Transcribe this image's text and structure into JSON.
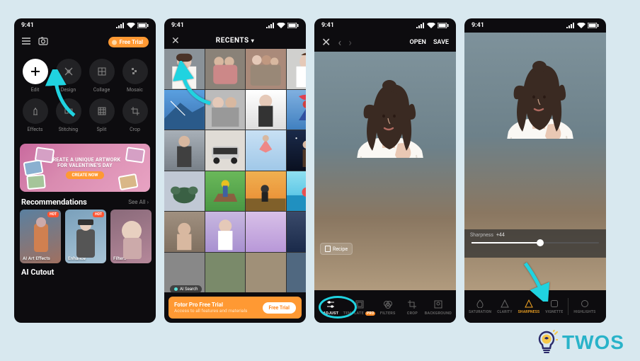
{
  "status": {
    "time": "9:41"
  },
  "phone1": {
    "free_trial": "Free Trial",
    "tools": [
      {
        "id": "edit",
        "label": "Edit"
      },
      {
        "id": "design",
        "label": "Design"
      },
      {
        "id": "collage",
        "label": "Collage"
      },
      {
        "id": "mosaic",
        "label": "Mosaic"
      },
      {
        "id": "effects",
        "label": "Effects"
      },
      {
        "id": "stitching",
        "label": "Stitching"
      },
      {
        "id": "split",
        "label": "Split"
      },
      {
        "id": "crop",
        "label": "Crop"
      }
    ],
    "banner": {
      "line1": "CREATE A UNIQUE ARTWORK",
      "line2": "FOR VALENTINE'S DAY",
      "cta": "CREATE NOW"
    },
    "recommendations": {
      "title": "Recommendations",
      "see_all": "See All ›"
    },
    "rec_items": [
      {
        "label": "AI Art Effects",
        "hot": true
      },
      {
        "label": "Enhance",
        "hot": true
      },
      {
        "label": "Filters",
        "hot": false
      }
    ],
    "ai_cutout": "AI Cutout"
  },
  "phone2": {
    "title": "RECENTS",
    "ai_search": "AI Search",
    "promo": {
      "title": "Fotor Pro Free Trial",
      "sub": "Access to all features and materials",
      "btn": "Free Trial"
    }
  },
  "phone3": {
    "open": "OPEN",
    "save": "SAVE",
    "recipe": "Recipe",
    "tabs": [
      {
        "id": "adjust",
        "label": "ADJUST",
        "active": true
      },
      {
        "id": "template",
        "label": "TEMPLATE",
        "pro": "PRO"
      },
      {
        "id": "filters",
        "label": "FILTERS"
      },
      {
        "id": "crop",
        "label": "CROP"
      },
      {
        "id": "background",
        "label": "BACKGROUND"
      }
    ]
  },
  "phone4": {
    "adjust": {
      "label": "Sharpness",
      "value": "+44"
    },
    "tabs": [
      {
        "id": "saturation",
        "label": "SATURATION"
      },
      {
        "id": "clarity",
        "label": "CLARITY"
      },
      {
        "id": "sharpness",
        "label": "SHARPNESS",
        "active": true
      },
      {
        "id": "vignette",
        "label": "VIGNETTE"
      },
      {
        "id": "highlights",
        "label": "HIGHLIGHTS"
      }
    ]
  },
  "twos": "TWOS"
}
